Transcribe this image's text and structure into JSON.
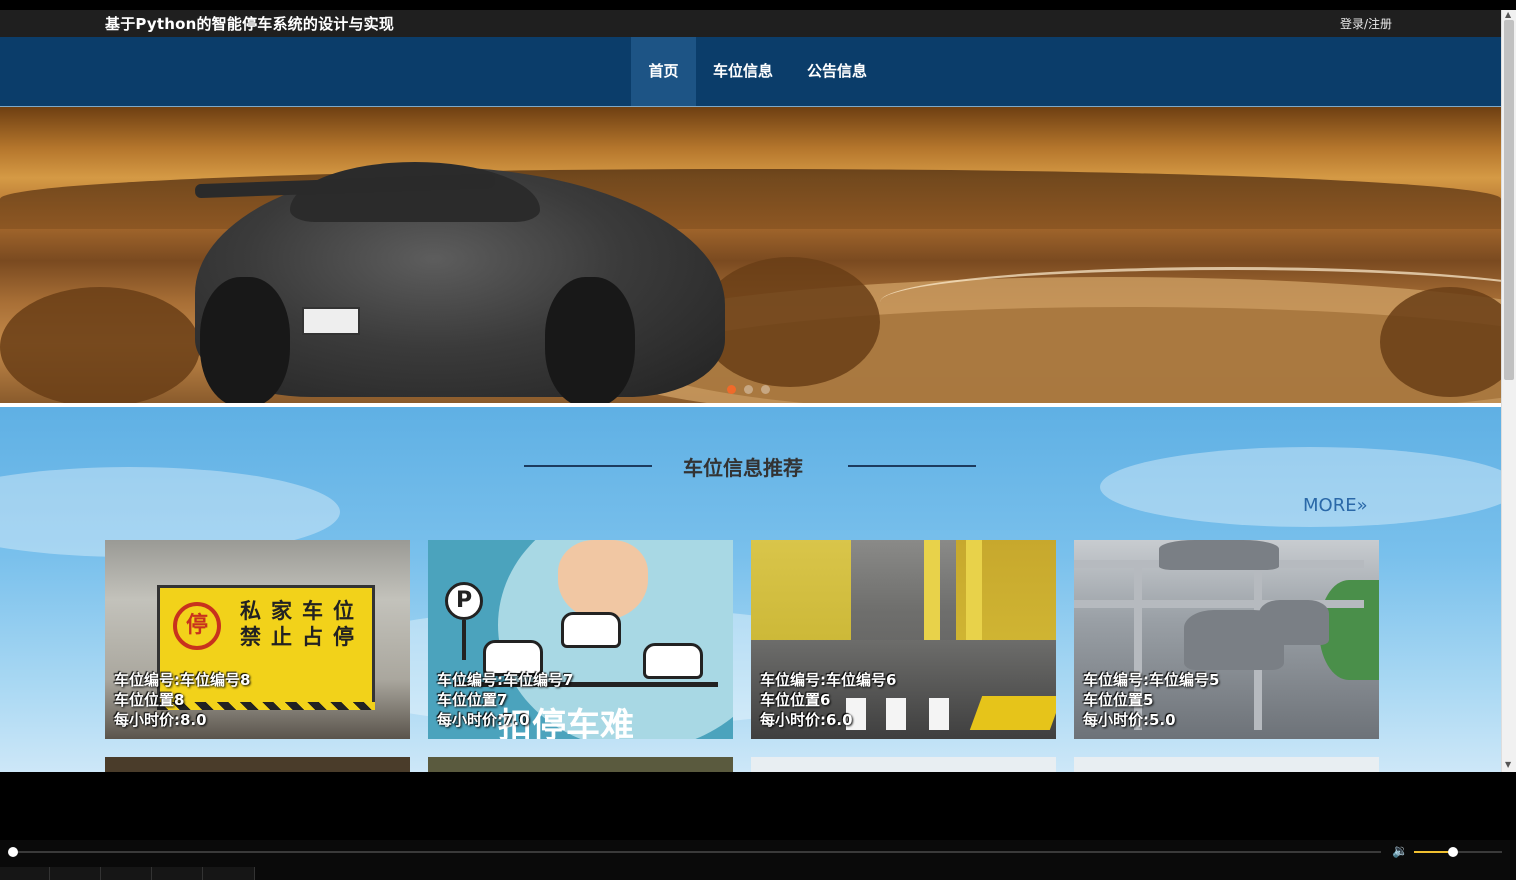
{
  "header": {
    "title": "基于Python的智能停车系统的设计与实现",
    "login_register": "登录/注册"
  },
  "nav": {
    "items": [
      {
        "label": "首页",
        "active": true
      },
      {
        "label": "车位信息",
        "active": false
      },
      {
        "label": "公告信息",
        "active": false
      }
    ]
  },
  "banner": {
    "slide_count": 3,
    "active_slide": 1
  },
  "recommend": {
    "title": "车位信息推荐",
    "more_label": "MORE»",
    "cards": [
      {
        "line1": "车位编号:车位编号8",
        "line2": "车位位置8",
        "line3": "每小时价:8.0"
      },
      {
        "line1": "车位编号:车位编号7",
        "line2": "车位位置7",
        "line3": "每小时价:7.0"
      },
      {
        "line1": "车位编号:车位编号6",
        "line2": "车位位置6",
        "line3": "每小时价:6.0"
      },
      {
        "line1": "车位编号:车位编号5",
        "line2": "车位位置5",
        "line3": "每小时价:5.0"
      }
    ],
    "card1_image": {
      "sign_glyph": "停",
      "sign_text": "私家车位 禁止占停"
    },
    "card2_image": {
      "p_glyph": "P",
      "big_text": "扣停车难"
    }
  },
  "player": {
    "progress": 0.0,
    "volume": 0.45
  },
  "colors": {
    "topbar": "#1f1f1f",
    "navbar": "#0b3d6a",
    "nav_active": "#1d5485",
    "more_link": "#2a68a8",
    "active_dot": "#f06a2a",
    "volume_fill": "#f0c030"
  }
}
